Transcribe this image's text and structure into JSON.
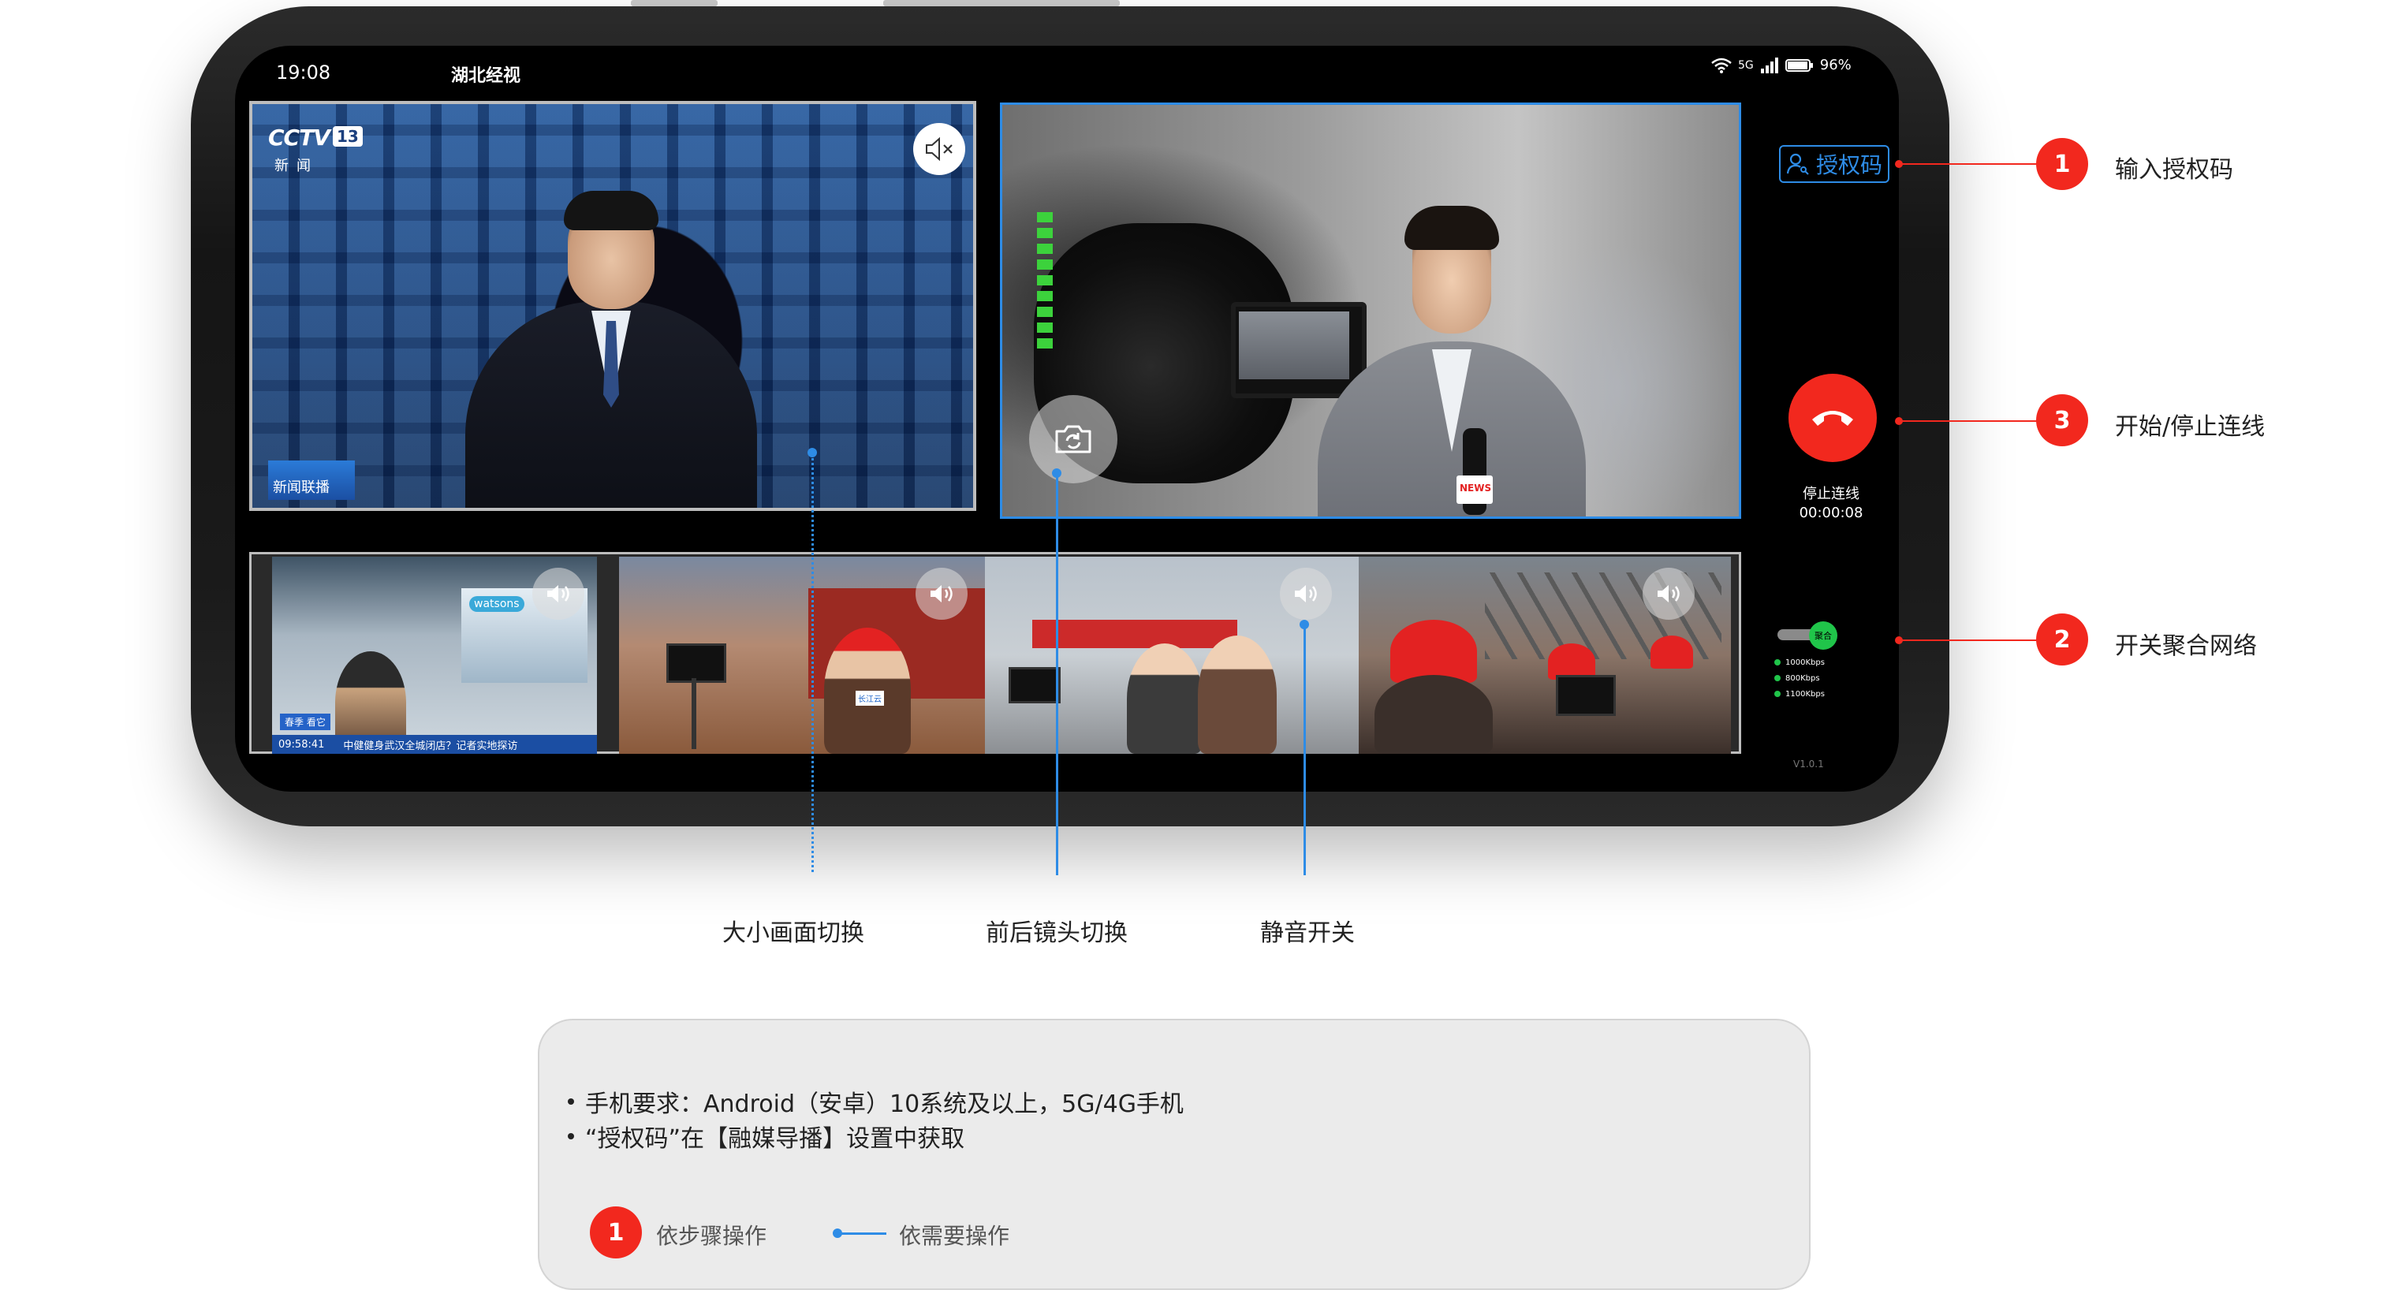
{
  "status_bar": {
    "time": "19:08",
    "title": "湖北经视",
    "network": "5G",
    "battery": "96%"
  },
  "main_left": {
    "channel_logo": "CCTV",
    "channel_number": "13",
    "channel_sub": "新闻",
    "program_badge": "新闻联播",
    "mute_icon": "speaker-mute-icon"
  },
  "main_right": {
    "flip_icon": "camera-flip-icon",
    "news_flag": "NEWS"
  },
  "thumbnails": [
    {
      "store": "watsons",
      "tag": "春季 看它",
      "time": "09:58:41",
      "ticker": "中健健身武汉全城闭店？记者实地探访"
    },
    {
      "mic": "长江云"
    },
    {},
    {}
  ],
  "right_rail": {
    "auth_label": "授权码",
    "hangup_label": "停止连线",
    "hangup_time": "00:00:08",
    "toggle_label": "聚合",
    "rates": [
      "1000Kbps",
      "800Kbps",
      "1100Kbps"
    ],
    "version": "V1.0.1"
  },
  "callouts": [
    {
      "number": "1",
      "text": "输入授权码"
    },
    {
      "number": "3",
      "text": "开始/停止连线"
    },
    {
      "number": "2",
      "text": "开关聚合网络"
    }
  ],
  "bottom_labels": {
    "switch_view": "大小画面切换",
    "switch_camera": "前后镜头切换",
    "mute_toggle": "静音开关"
  },
  "info": {
    "requirements": [
      "手机要求：Android（安卓）10系统及以上，5G/4G手机",
      "“授权码”在【融媒导播】设置中获取"
    ],
    "legend_step_number": "1",
    "legend_step": "依步骤操作",
    "legend_optional": "依需要操作"
  },
  "colors": {
    "accent_red": "#f2281e",
    "accent_blue": "#2e8ce6",
    "level_green": "#3cd23c",
    "toggle_green": "#20c54a"
  }
}
